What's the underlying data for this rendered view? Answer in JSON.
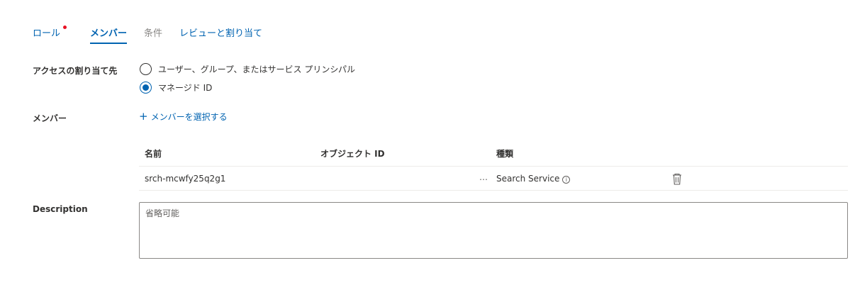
{
  "tabs": [
    {
      "label": "ロール",
      "state": "link",
      "required": true
    },
    {
      "label": "メンバー",
      "state": "active"
    },
    {
      "label": "条件",
      "state": "disabled"
    },
    {
      "label": "レビューと割り当て",
      "state": "link"
    }
  ],
  "assign_access": {
    "label": "アクセスの割り当て先",
    "options": [
      {
        "label": "ユーザー、グループ、またはサービス プリンシパル",
        "checked": false
      },
      {
        "label": "マネージド ID",
        "checked": true
      }
    ]
  },
  "members": {
    "label": "メンバー",
    "add_link": "メンバーを選択する",
    "columns": {
      "name": "名前",
      "object_id": "オブジェクト ID",
      "type": "種類"
    },
    "rows": [
      {
        "name": "srch-mcwfy25q2g1",
        "object_id": "",
        "more": "…",
        "type": "Search Service"
      }
    ]
  },
  "description": {
    "label": "Description",
    "placeholder": "省略可能"
  },
  "colors": {
    "accent": "#0063b1",
    "required_dot": "#e81123",
    "text": "#323130",
    "border": "#8a8886"
  }
}
